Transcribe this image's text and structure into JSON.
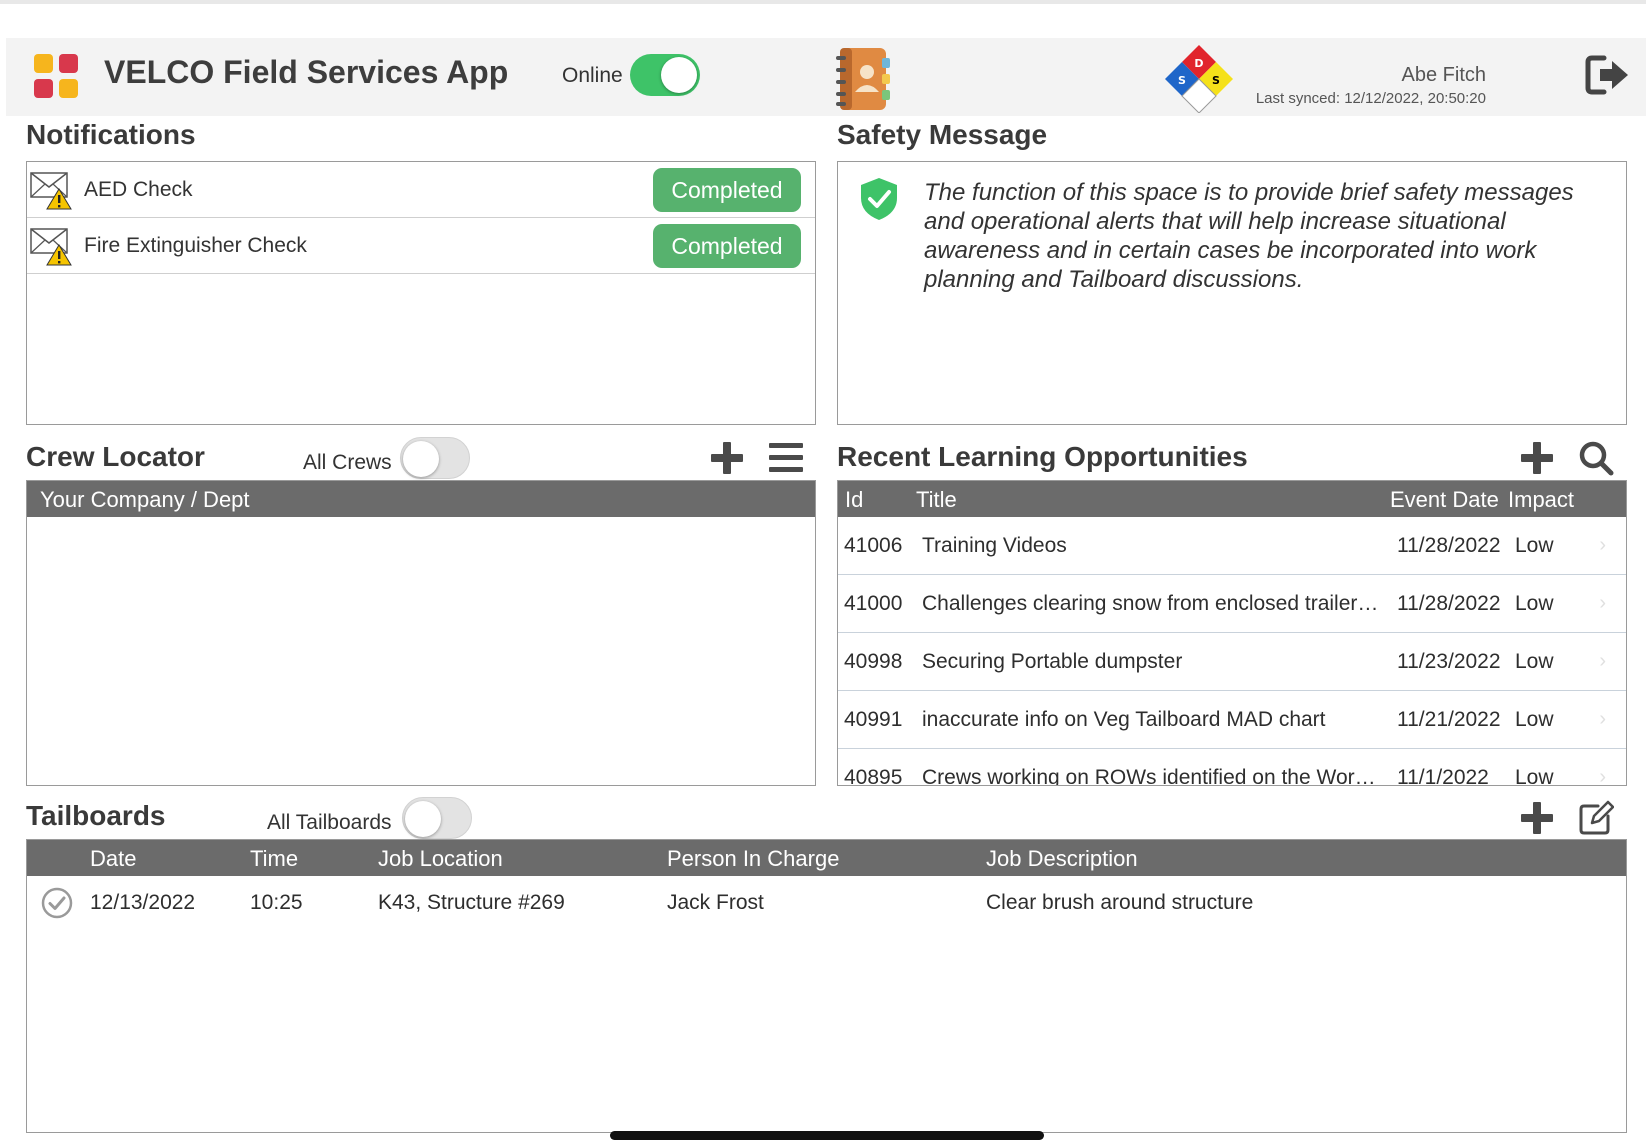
{
  "header": {
    "app_title": "VELCO Field Services App",
    "online_label": "Online",
    "online_enabled": true,
    "user_name": "Abe Fitch",
    "last_synced": "Last synced: 12/12/2022, 20:50:20",
    "icons": {
      "app_menu": "app-grid-icon",
      "contacts": "contacts-book-icon",
      "nfpa": "nfpa-diamond-icon",
      "logout": "logout-icon"
    },
    "nfpa_letters": {
      "top": "D",
      "left": "S",
      "right": "S"
    },
    "app_grid_colors": [
      "#f6b51d",
      "#d8384c",
      "#d8384c",
      "#f6b51d"
    ]
  },
  "notifications": {
    "title": "Notifications",
    "items": [
      {
        "label": "AED Check",
        "status": "Completed"
      },
      {
        "label": "Fire Extinguisher Check",
        "status": "Completed"
      }
    ],
    "status_color": "#57b26e"
  },
  "safety": {
    "title": "Safety Message",
    "message": "The function of this space is to provide brief safety messages and operational alerts that will help increase situational awareness and in certain cases be incorporated into work planning and Tailboard discussions.",
    "icon": "shield-check-icon",
    "icon_color": "#3ec368"
  },
  "crew_locator": {
    "title": "Crew Locator",
    "toggle_label": "All Crews",
    "toggle_enabled": false,
    "column": "Your Company / Dept",
    "icons": {
      "add": "plus-icon",
      "menu": "hamburger-icon"
    }
  },
  "learning": {
    "title": "Recent Learning Opportunities",
    "columns": {
      "id": "Id",
      "title": "Title",
      "date": "Event Date",
      "impact": "Impact"
    },
    "rows": [
      {
        "id": "41006",
        "title": "Training Videos",
        "date": "11/28/2022",
        "impact": "Low"
      },
      {
        "id": "41000",
        "title": "Challenges clearing snow from enclosed trailer…",
        "date": "11/28/2022",
        "impact": "Low"
      },
      {
        "id": "40998",
        "title": "Securing Portable dumpster",
        "date": "11/23/2022",
        "impact": "Low"
      },
      {
        "id": "40991",
        "title": "inaccurate info on Veg Tailboard MAD chart",
        "date": "11/21/2022",
        "impact": "Low"
      },
      {
        "id": "40895",
        "title": "Crews working on ROWs identified on the Wor…",
        "date": "11/1/2022",
        "impact": "Low"
      }
    ],
    "row_chevron": "›",
    "icons": {
      "add": "plus-icon",
      "search": "search-icon"
    }
  },
  "tailboards": {
    "title": "Tailboards",
    "toggle_label": "All Tailboards",
    "toggle_enabled": false,
    "columns": {
      "date": "Date",
      "time": "Time",
      "location": "Job Location",
      "person": "Person In Charge",
      "description": "Job Description"
    },
    "rows": [
      {
        "date": "12/13/2022",
        "time": "10:25",
        "location": "K43, Structure #269",
        "person": "Jack Frost",
        "description": "Clear brush around structure"
      }
    ],
    "icons": {
      "add": "plus-icon",
      "edit": "edit-icon",
      "row_status": "check-circle-icon"
    }
  }
}
